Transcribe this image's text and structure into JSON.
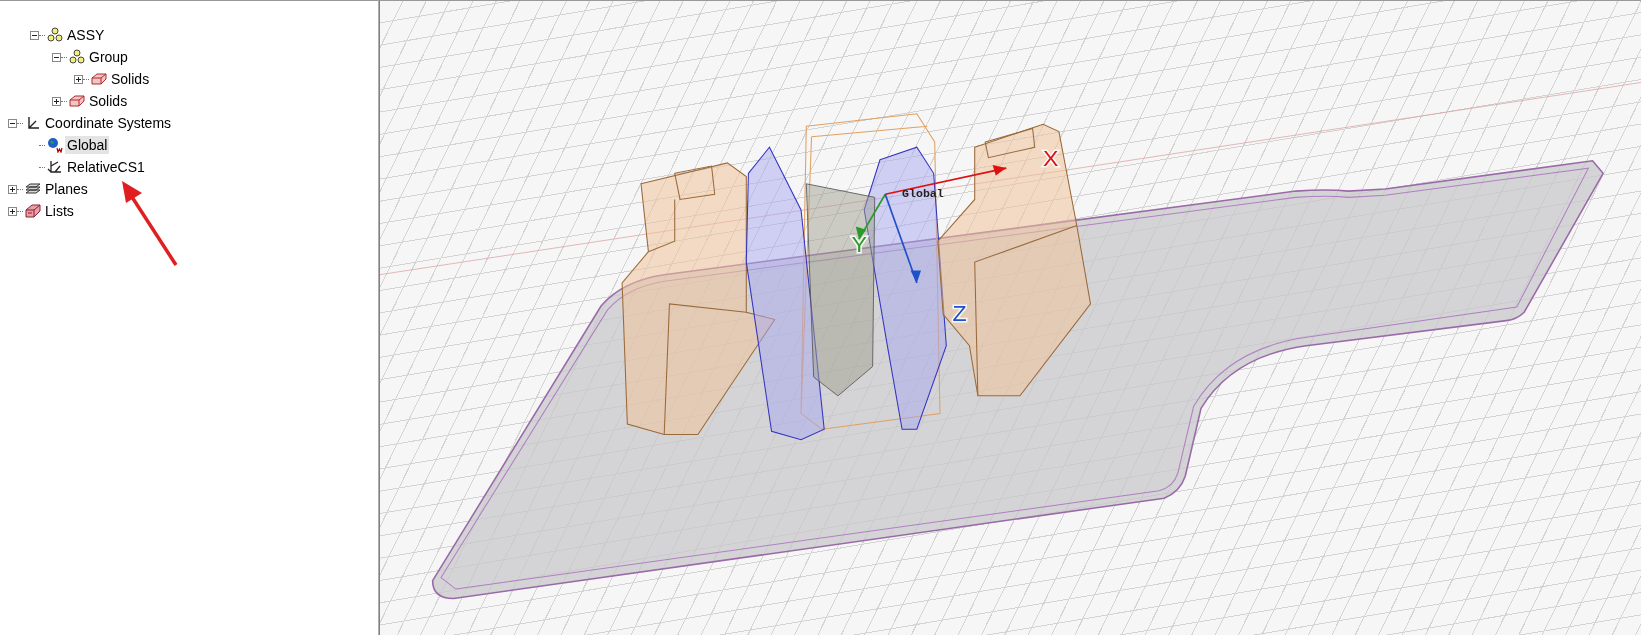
{
  "tree": {
    "model_items": [
      {
        "label": "ASSY",
        "kind": "assembly",
        "expanded": true,
        "selected": false,
        "children": [
          {
            "label": "Group",
            "kind": "assembly",
            "expanded": true,
            "selected": false,
            "children": [
              {
                "label": "Solids",
                "kind": "solid",
                "expanded": false,
                "selected": false
              }
            ]
          },
          {
            "label": "Solids",
            "kind": "solid",
            "expanded": false,
            "selected": false
          }
        ]
      }
    ],
    "items": [
      {
        "label": "Coordinate Systems",
        "kind": "coordinate_system",
        "expanded": true,
        "selected": false,
        "children": [
          {
            "label": "Global",
            "kind": "global_cs",
            "selected": true
          },
          {
            "label": "RelativeCS1",
            "kind": "relative_cs",
            "selected": false
          }
        ]
      },
      {
        "label": "Planes",
        "kind": "planes",
        "expanded": false,
        "selected": false
      },
      {
        "label": "Lists",
        "kind": "lists",
        "expanded": false,
        "selected": false
      }
    ]
  },
  "viewport": {
    "origin_label": "Global",
    "axes": [
      {
        "kind": "x",
        "label": "X"
      },
      {
        "kind": "y",
        "label": "Y"
      },
      {
        "kind": "z",
        "label": "Z"
      }
    ]
  }
}
